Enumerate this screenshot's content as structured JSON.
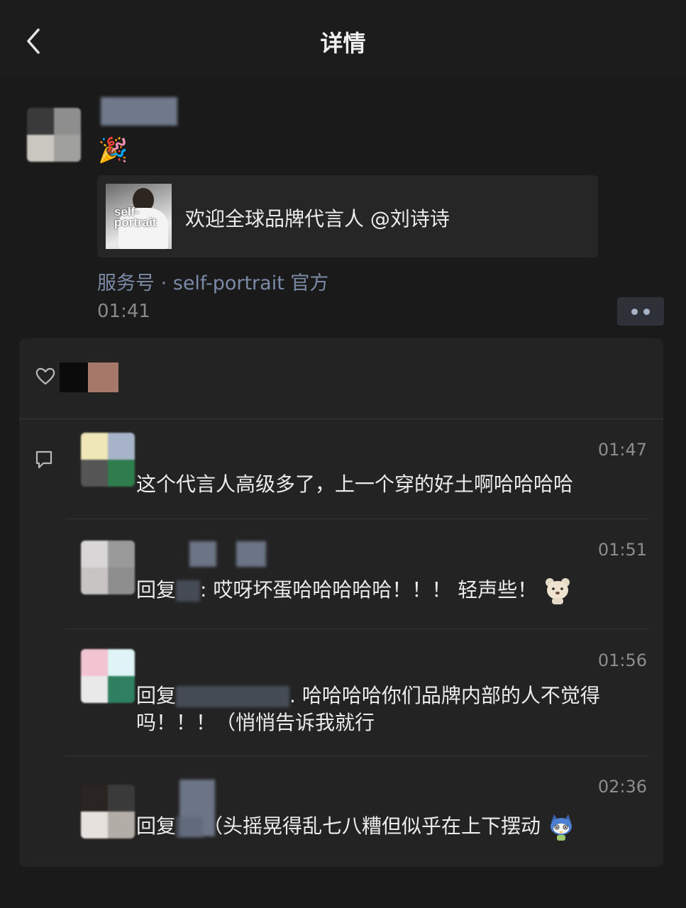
{
  "nav": {
    "title": "详情"
  },
  "post": {
    "emoji": "🎉",
    "share": {
      "thumb_text": "self-\nportrait",
      "title": "欢迎全球品牌代言人 @刘诗诗"
    },
    "source": "服务号 · self-portrait 官方",
    "time": "01:41"
  },
  "comments": [
    {
      "time": "01:47",
      "text": "这个代言人高级多了，上一个穿的好土啊哈哈哈哈"
    },
    {
      "time": "01:51",
      "reply_label": "回复",
      "text": ": 哎呀坏蛋哈哈哈哈哈！！！ 轻声些！"
    },
    {
      "time": "01:56",
      "reply_label": "回复",
      "text": ". 哈哈哈哈你们品牌内部的人不觉得吗！！！（悄悄告诉我就行"
    },
    {
      "time": "02:36",
      "reply_label": "回复",
      "text": "（头摇晃得乱七八糟但似乎在上下摆动"
    }
  ],
  "colors": {
    "background": "#1a1a1a",
    "panel": "#232323",
    "link": "#7b8aa6",
    "text": "#ececec",
    "muted": "#8d8d8d"
  },
  "icons": [
    "back-arrow-icon",
    "party-popper-icon",
    "more-icon",
    "like-heart-icon",
    "comment-icon",
    "bear-emoji-icon",
    "blue-bird-emoji-icon"
  ]
}
